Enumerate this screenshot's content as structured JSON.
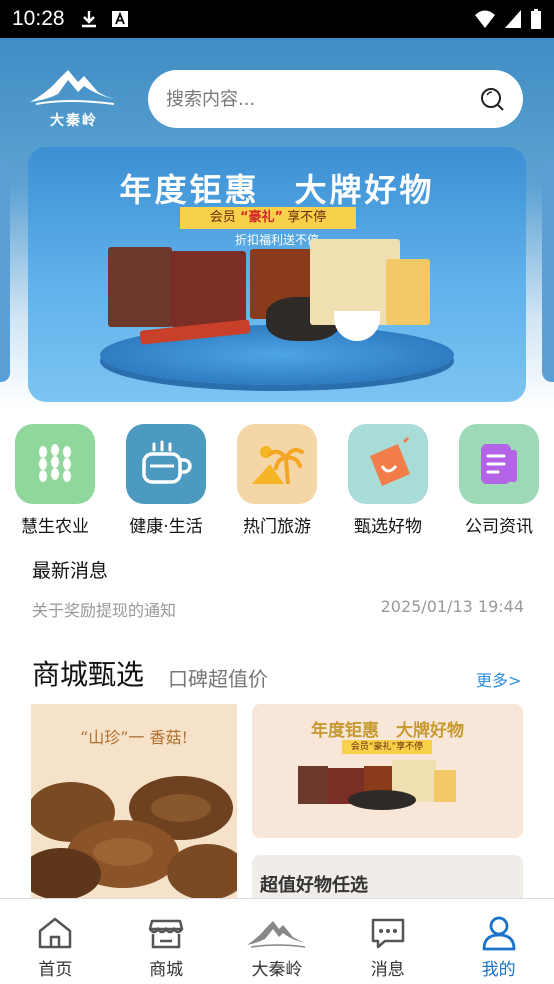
{
  "status_bar": {
    "time": "10:28"
  },
  "header": {
    "logo_text": "大秦岭",
    "search": {
      "placeholder": "搜索内容..."
    }
  },
  "banner": {
    "title": "年度钜惠　大牌好物",
    "tag_prefix": "会员",
    "tag_highlight": "“豪礼”",
    "tag_suffix": "享不停",
    "subtitle": "折扣福利送不停"
  },
  "categories": [
    {
      "label": "慧生农业",
      "icon": "wheat-icon",
      "color": "#8fd79a"
    },
    {
      "label": "健康·生活",
      "icon": "coffee-cup-icon",
      "color": "#4d9ac1"
    },
    {
      "label": "热门旅游",
      "icon": "palm-tree-icon",
      "color": "#f4d6a7"
    },
    {
      "label": "甄选好物",
      "icon": "shopping-bag-icon",
      "color": "#a9dcd6"
    },
    {
      "label": "公司资讯",
      "icon": "newspaper-icon",
      "color": "#9ed9b7"
    }
  ],
  "news": {
    "title": "最新消息",
    "item": {
      "text": "关于奖励提现的通知",
      "time": "2025/01/13 19:44"
    }
  },
  "mall": {
    "title": "商城甄选",
    "subtitle": "口碑超值价",
    "more": "更多>",
    "card_left_caption": "“山珍”一 香菇!",
    "card_right_title": "年度钜惠　大牌好物",
    "card_right_tag": "会员“豪礼”享不停",
    "card_bottom_title": "超值好物任选"
  },
  "tabbar": [
    {
      "label": "首页",
      "icon": "home-icon",
      "active": false
    },
    {
      "label": "商城",
      "icon": "store-icon",
      "active": false
    },
    {
      "label": "大秦岭",
      "icon": "mountain-logo-icon",
      "active": false
    },
    {
      "label": "消息",
      "icon": "message-icon",
      "active": false
    },
    {
      "label": "我的",
      "icon": "user-icon",
      "active": true
    }
  ],
  "colors": {
    "accent": "#1b72c9",
    "more_link": "#2f8fe0"
  }
}
